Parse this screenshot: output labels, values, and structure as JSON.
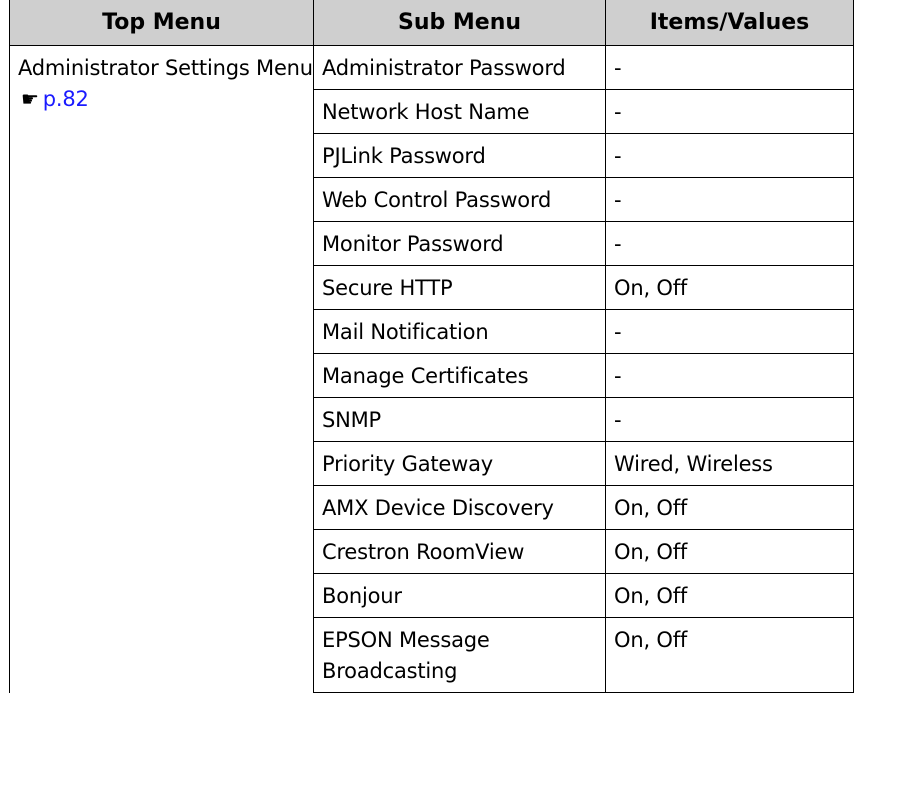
{
  "headers": {
    "top_menu": "Top Menu",
    "sub_menu": "Sub Menu",
    "items_values": "Items/Values"
  },
  "top_menu": {
    "label": "Administrator Settings Menu",
    "icon": "pointing-hand-icon",
    "ref_link": "p.82",
    "link_color": "#1a1aff"
  },
  "header_bg_color": "#cfcfcf",
  "rows": [
    {
      "sub": "Administrator Password",
      "value": "-"
    },
    {
      "sub": "Network Host Name",
      "value": "-"
    },
    {
      "sub": "PJLink Password",
      "value": "-"
    },
    {
      "sub": "Web Control Password",
      "value": "-"
    },
    {
      "sub": "Monitor Password",
      "value": "-"
    },
    {
      "sub": "Secure HTTP",
      "value": "On, Off"
    },
    {
      "sub": "Mail Notification",
      "value": "-"
    },
    {
      "sub": "Manage Certificates",
      "value": "-"
    },
    {
      "sub": "SNMP",
      "value": "-"
    },
    {
      "sub": "Priority Gateway",
      "value": "Wired, Wireless"
    },
    {
      "sub": "AMX Device Discovery",
      "value": "On, Off"
    },
    {
      "sub": "Crestron RoomView",
      "value": "On, Off"
    },
    {
      "sub": "Bonjour",
      "value": "On, Off"
    },
    {
      "sub": "EPSON Message Broadcasting",
      "value": "On, Off"
    }
  ]
}
